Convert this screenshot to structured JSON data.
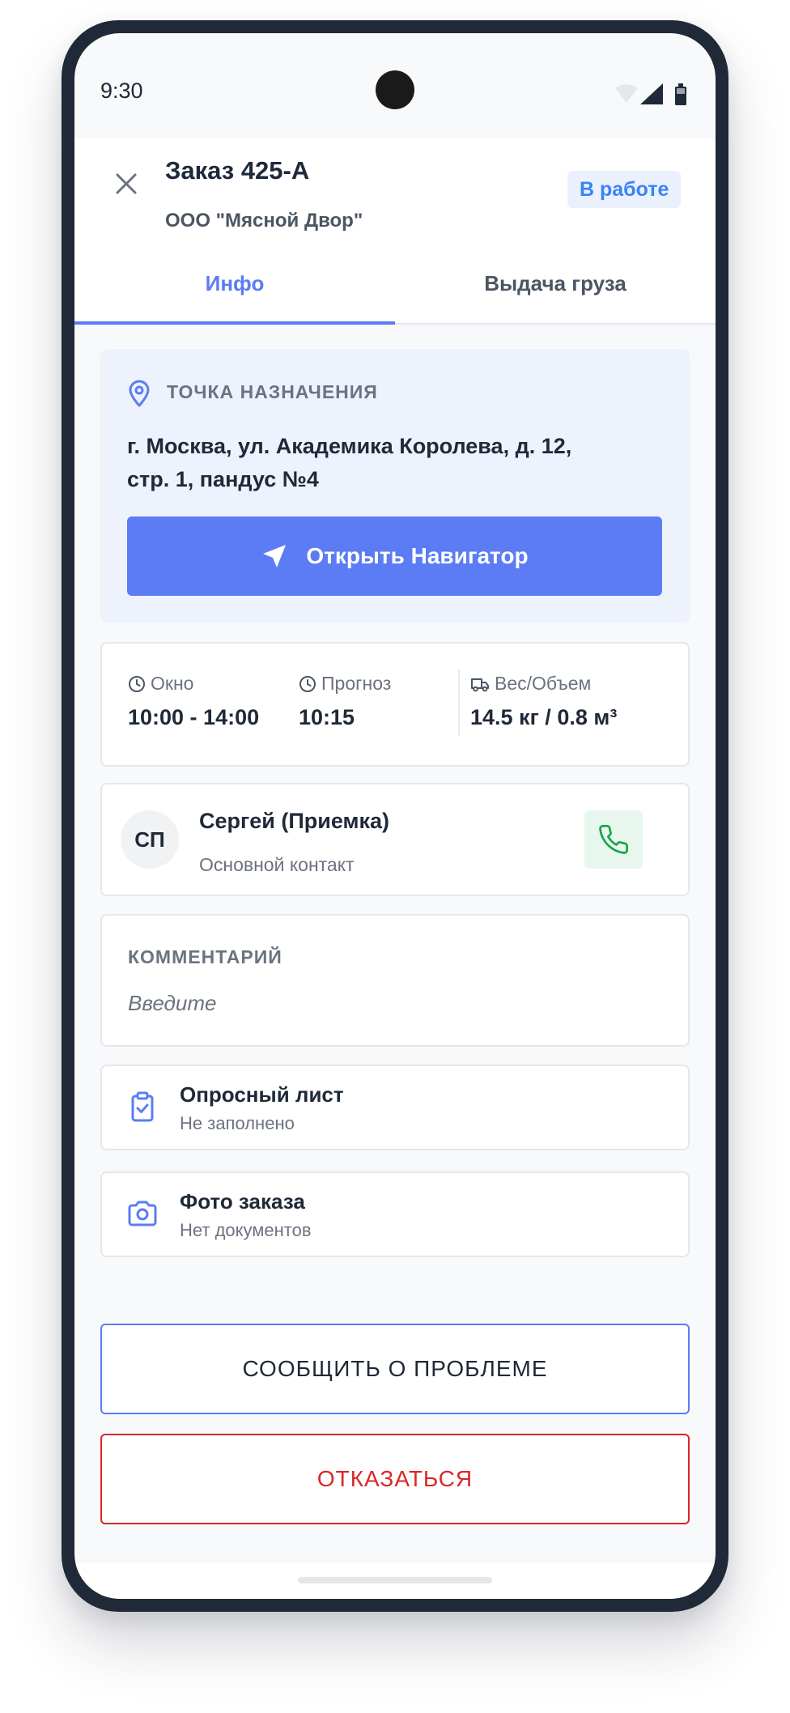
{
  "status_bar": {
    "time": "9:30"
  },
  "header": {
    "order_title": "Заказ 425-А",
    "client": "ООО \"Мясной Двор\"",
    "status_badge": "В работе"
  },
  "tabs": [
    {
      "label": "Инфо",
      "active": true
    },
    {
      "label": "Выдача груза",
      "active": false
    }
  ],
  "destination": {
    "label": "ТОЧКА НАЗНАЧЕНИЯ",
    "address": "г. Москва, ул. Академика Королева, д. 12, стр. 1, пандус №4",
    "navigator_button": "Открыть Навигатор"
  },
  "stats": [
    {
      "icon": "clock-icon",
      "label": "Окно",
      "value": "10:00 - 14:00"
    },
    {
      "icon": "clock-icon",
      "label": "Прогноз",
      "value": "10:15"
    },
    {
      "icon": "truck-icon",
      "label": "Вес/Объем",
      "value": "14.5 кг / 0.8 м³"
    }
  ],
  "contact": {
    "initials": "СП",
    "name": "Сергей (Приемка)",
    "role": "Основной контакт"
  },
  "comment": {
    "label": "КОММЕНТАРИЙ",
    "placeholder": "Введите",
    "value": ""
  },
  "list_items": [
    {
      "icon": "clipboard-check-icon",
      "title": "Опросный лист",
      "subtitle": "Не заполнено"
    },
    {
      "icon": "camera-icon",
      "title": "Фото заказа",
      "subtitle": "Нет документов"
    }
  ],
  "actions": {
    "report_problem": "СООБЩИТЬ О ПРОБЛЕМЕ",
    "refuse": "ОТКАЗАТЬСЯ"
  },
  "colors": {
    "accent": "#5b7cf4",
    "danger": "#dc2626",
    "success": "#16a34a",
    "badge_text": "#3b82f6"
  }
}
